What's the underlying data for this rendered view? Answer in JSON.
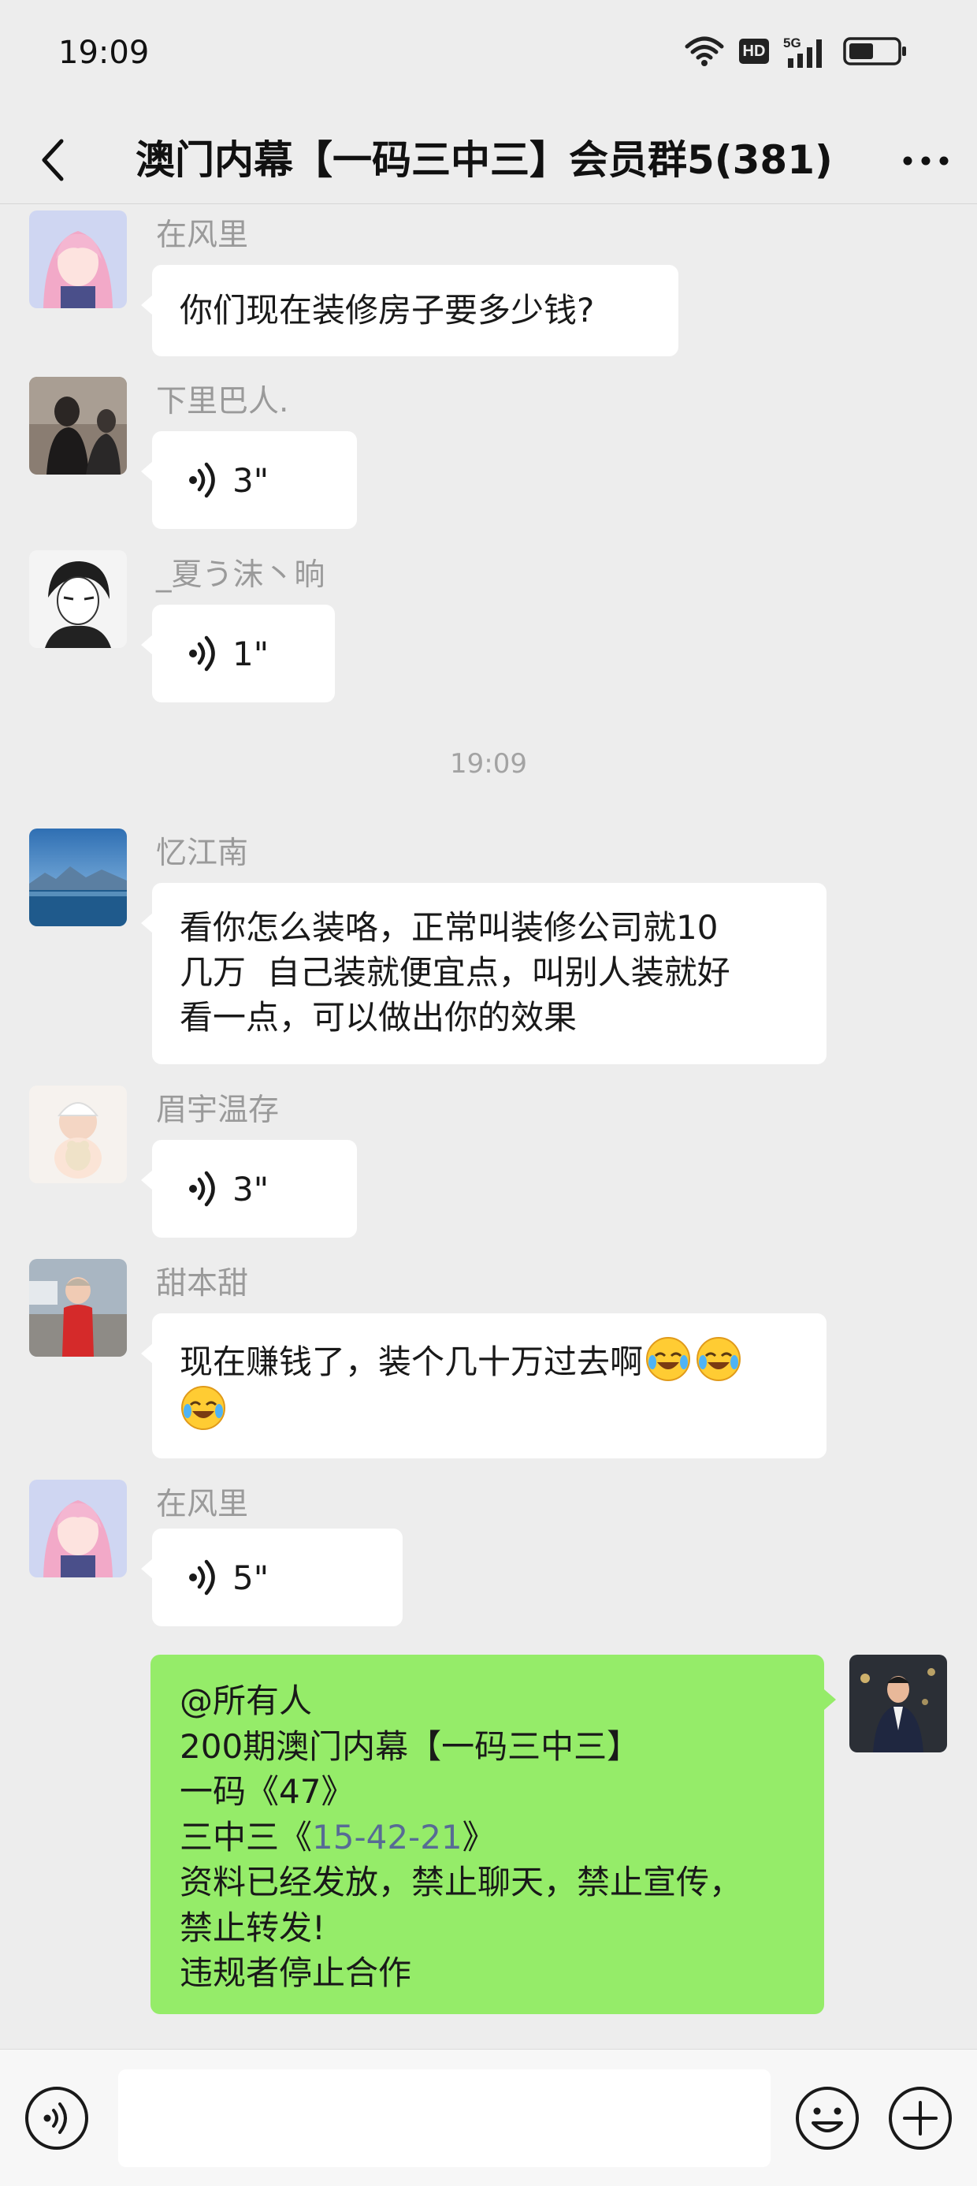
{
  "status_bar": {
    "time": "19:09",
    "network_badge": "HD",
    "network_type": "5G",
    "icons": [
      "wifi-icon",
      "hd-icon",
      "signal-5g-icon",
      "battery-icon"
    ]
  },
  "nav": {
    "title": "澳门内幕【一码三中三】会员群5(381)",
    "back_icon": "chevron-left-icon",
    "more_icon": "more-dots-icon"
  },
  "messages": [
    {
      "sender": "在风里",
      "type": "text",
      "text": "你们现在装修房子要多少钱?"
    },
    {
      "sender": "下里巴人.",
      "type": "voice",
      "duration": "3\""
    },
    {
      "sender": "_夏う沫丶晌",
      "type": "voice",
      "duration": "1\""
    },
    {
      "sender": "忆江南",
      "type": "text",
      "lines": [
        "看你怎么装咯，正常叫装修公司就10",
        "几万  自己装就便宜点，叫别人装就好",
        "看一点，可以做出你的效果"
      ]
    },
    {
      "sender": "眉宇温存",
      "type": "voice",
      "duration": "3\""
    },
    {
      "sender": "甜本甜",
      "type": "text",
      "lines": [
        "现在赚钱了，装个几十万过去啊"
      ],
      "emoji": "laughing-crying-emoji"
    },
    {
      "sender": "在风里",
      "type": "voice",
      "duration": "5\""
    }
  ],
  "timestamp": "19:09",
  "sent_message": {
    "line1": "@所有人",
    "line2": "200期澳门内幕【一码三中三】",
    "line3": "一码《47》",
    "line4_prefix": "三中三《",
    "line4_highlight": "15-42-21",
    "line4_suffix": "》",
    "line5": "资料已经发放，禁止聊天，禁止宣传，",
    "line6": "禁止转发!",
    "line7": "违规者停止合作"
  },
  "input_bar": {
    "placeholder": "",
    "icons": [
      "voice-input-icon",
      "emoji-icon",
      "plus-icon"
    ]
  },
  "colors": {
    "background": "#ededed",
    "sent_bubble": "#95ec69",
    "received_bubble": "#ffffff",
    "link": "#576b95"
  }
}
